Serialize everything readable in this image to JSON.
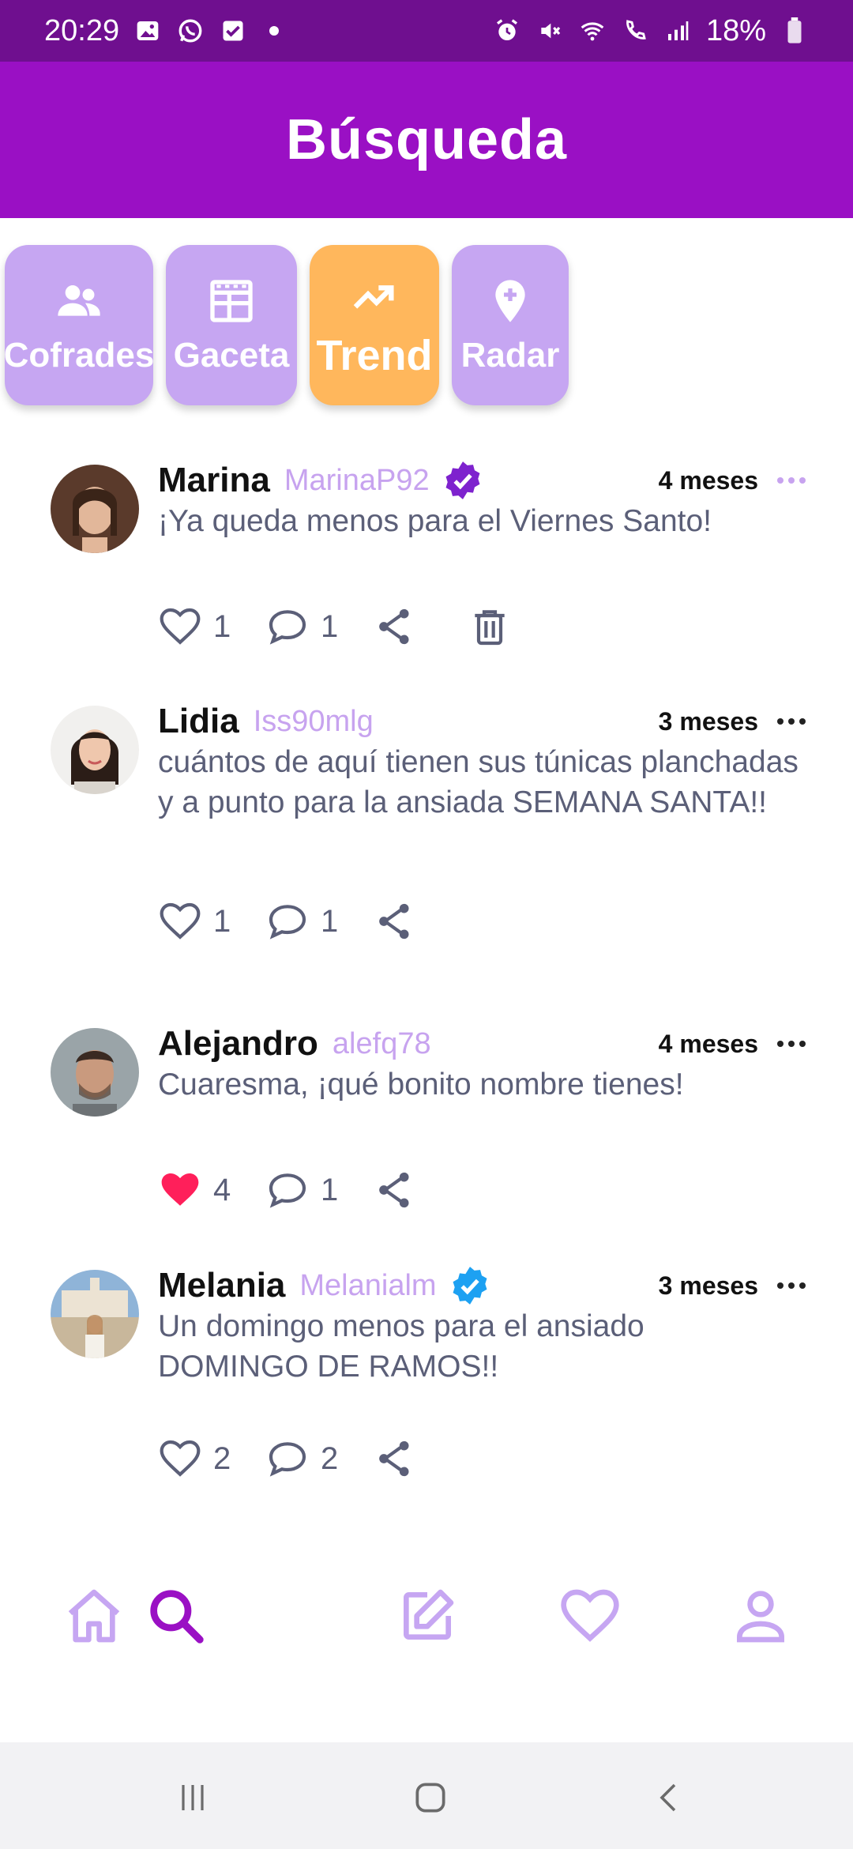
{
  "status_bar": {
    "time": "20:29",
    "battery": "18%",
    "left_icons": [
      "image-icon",
      "whatsapp-icon",
      "check-icon"
    ],
    "right_icons": [
      "alarm-icon",
      "mute-icon",
      "wifi-icon",
      "call-icon",
      "signal-icon",
      "battery-icon"
    ]
  },
  "app_bar": {
    "title": "Búsqueda",
    "color": "#9a10c4"
  },
  "categories": [
    {
      "label": "Cofrades",
      "icon": "people-icon",
      "active": false
    },
    {
      "label": "Gaceta",
      "icon": "newspaper-icon",
      "active": false
    },
    {
      "label": "Trend",
      "icon": "trending-icon",
      "active": true
    },
    {
      "label": "Radar",
      "icon": "location-pin-icon",
      "active": false
    }
  ],
  "posts": [
    {
      "author": "Marina",
      "handle": "MarinaP92",
      "verified": true,
      "verified_color": "#7e22ce",
      "time": "4 meses",
      "text": "¡Ya queda menos para el Viernes Santo!",
      "likes": "1",
      "liked": false,
      "comments": "1",
      "deletable": true
    },
    {
      "author": "Lidia",
      "handle": "Iss90mlg",
      "verified": false,
      "time": "3 meses",
      "text": "cuántos de aquí tienen sus túnicas planchadas y a punto para la ansiada SEMANA SANTA!!",
      "likes": "1",
      "liked": false,
      "comments": "1",
      "deletable": false
    },
    {
      "author": "Alejandro",
      "handle": "alefq78",
      "verified": false,
      "time": "4 meses",
      "text": "Cuaresma, ¡qué bonito nombre tienes!",
      "likes": "4",
      "liked": true,
      "comments": "1",
      "deletable": false
    },
    {
      "author": "Melania",
      "handle": "Melanialm",
      "verified": true,
      "verified_color": "#1da1f2",
      "time": "3 meses",
      "text": "Un domingo menos para el ansiado DOMINGO DE RAMOS!!",
      "likes": "2",
      "liked": false,
      "comments": "2",
      "deletable": false
    }
  ],
  "bottom_nav": [
    {
      "icon": "home-icon",
      "active": false
    },
    {
      "icon": "search-icon",
      "active": true
    },
    {
      "icon": "edit-icon",
      "active": false
    },
    {
      "icon": "heart-icon",
      "active": false
    },
    {
      "icon": "profile-icon",
      "active": false
    }
  ],
  "colors": {
    "accent": "#9a10c4",
    "chip": "#c6a6f2",
    "chip_active": "#ffb75c",
    "like": "#ff1f5a",
    "handle": "#c7a3ef"
  }
}
